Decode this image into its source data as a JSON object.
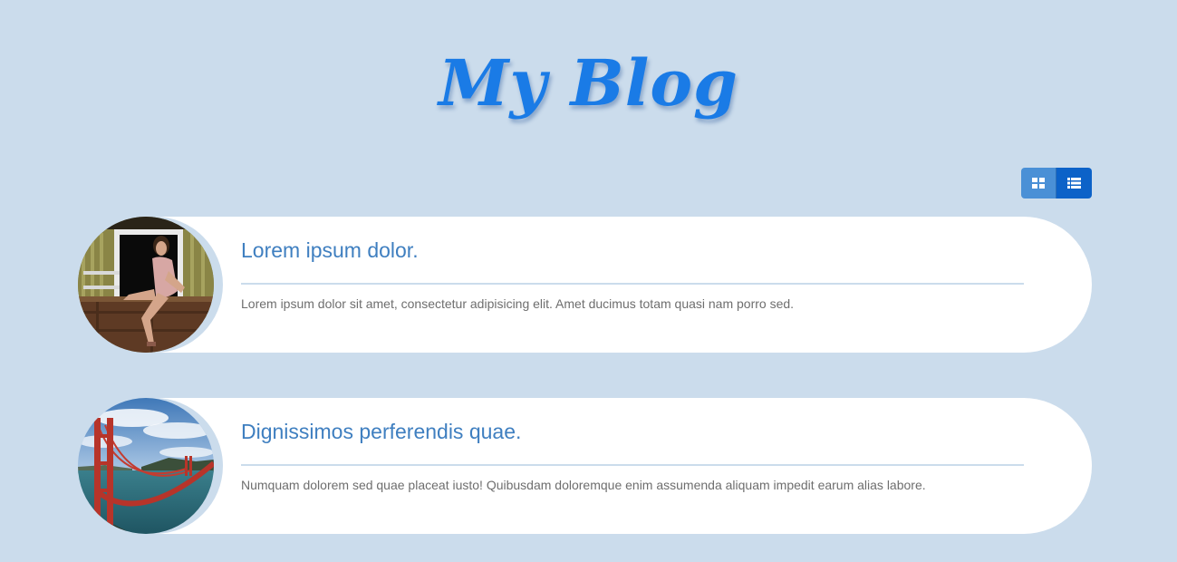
{
  "header": {
    "title": "My Blog"
  },
  "view_toggle": {
    "options": [
      "grid-icon",
      "list-icon"
    ],
    "active": "list"
  },
  "posts": [
    {
      "title": "Lorem ipsum dolor.",
      "excerpt": "Lorem ipsum dolor sit amet, consectetur adipisicing elit. Amet ducimus totam quasi nam porro sed.",
      "thumbnail": "woman-sitting-in-window-photo"
    },
    {
      "title": "Dignissimos perferendis quae.",
      "excerpt": "Numquam dolorem sed quae placeat iusto! Quibusdam doloremque enim assumenda aliquam impedit earum alias labore.",
      "thumbnail": "golden-gate-bridge-photo"
    }
  ],
  "colors": {
    "background": "#cbdcec",
    "accent": "#1a7be6",
    "post_title": "#3f7fc0"
  }
}
